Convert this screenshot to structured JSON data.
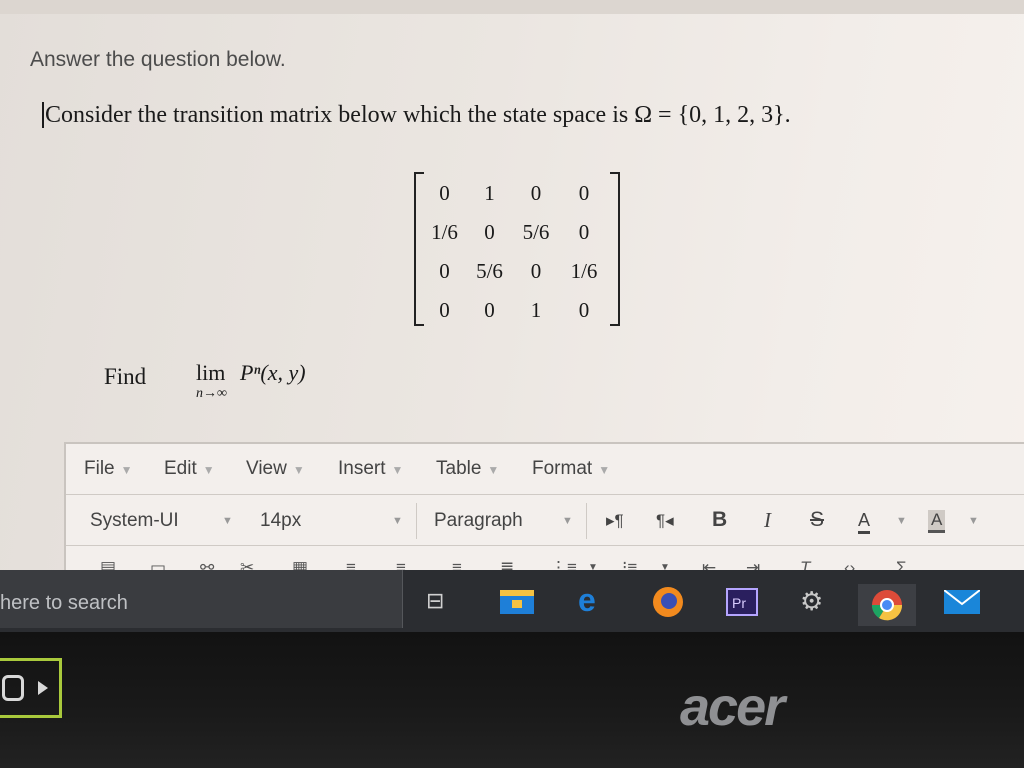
{
  "page": {
    "instruction": "Answer the question below.",
    "question": "Consider the transition matrix below which the state space is Ω = {0, 1, 2, 3}.",
    "matrix": [
      [
        "0",
        "1",
        "0",
        "0"
      ],
      [
        "1/6",
        "0",
        "5/6",
        "0"
      ],
      [
        "0",
        "5/6",
        "0",
        "1/6"
      ],
      [
        "0",
        "0",
        "1",
        "0"
      ]
    ],
    "find_label": "Find",
    "limit": {
      "operator": "lim",
      "subscript": "n→∞",
      "expression": "Pⁿ(x, y)"
    }
  },
  "editor": {
    "menu": [
      "File",
      "Edit",
      "View",
      "Insert",
      "Table",
      "Format"
    ],
    "font_family": "System-UI",
    "font_size": "14px",
    "block_format": "Paragraph",
    "format_buttons": {
      "ltr": "▸¶",
      "rtl": "¶◂",
      "bold": "B",
      "italic": "I",
      "strike": "S",
      "text_color": "A",
      "bg_color": "A"
    }
  },
  "taskbar": {
    "search_placeholder": "here to search"
  },
  "bezel": {
    "brand": "acer"
  },
  "colors": {
    "page_background": "#ebe6e1",
    "taskbar": "#2b2d31",
    "edge_blue": "#1e7fd8",
    "firefox_orange": "#f28a1e",
    "premiere_purple": "#2a1f5e",
    "chrome_red": "#dd4b39",
    "mail_blue": "#1a86d9",
    "explorer_yellow": "#f5c242"
  }
}
